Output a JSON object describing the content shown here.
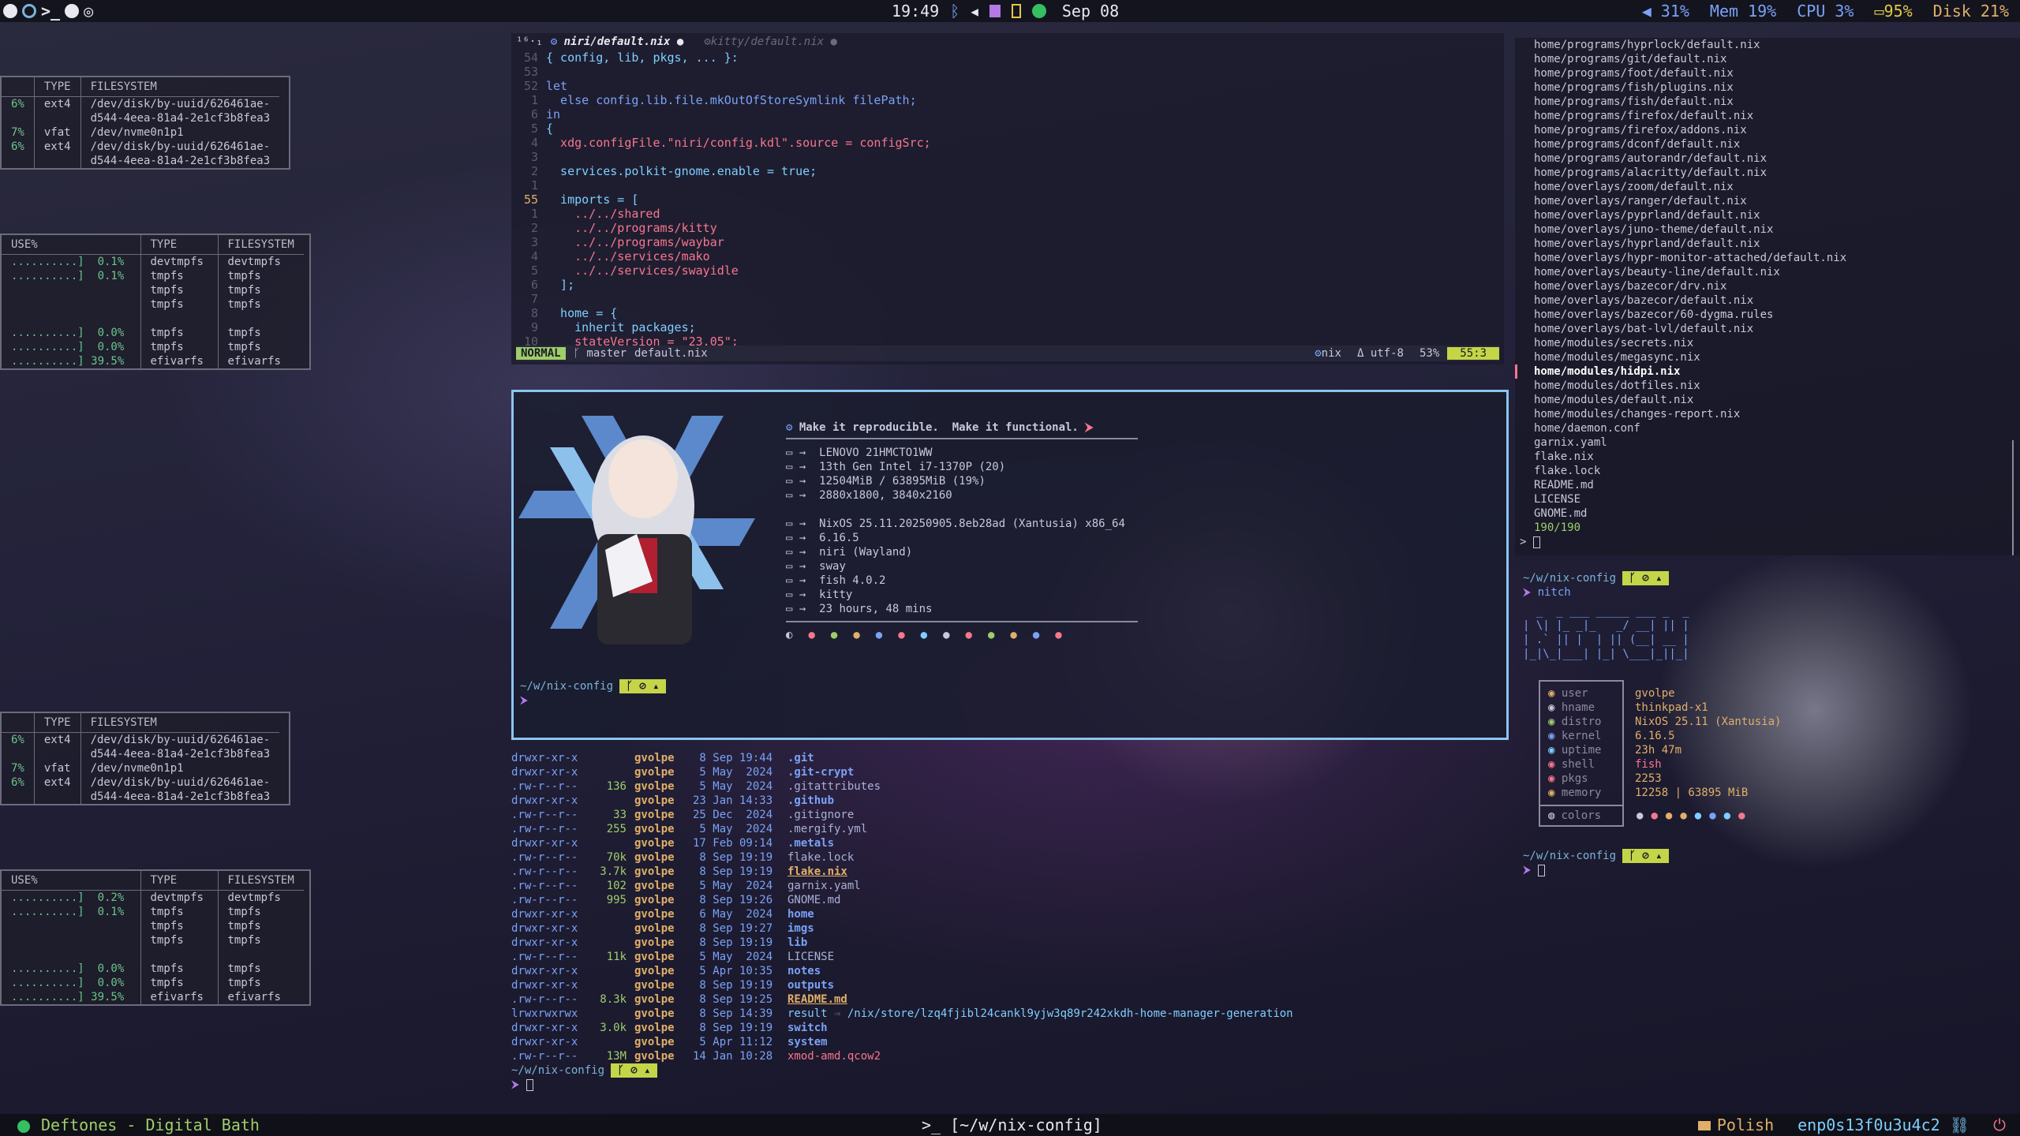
{
  "topbar": {
    "left_icons": [
      "nixos-icon",
      "firefox-icon",
      "terminal-icon",
      "telegram-icon",
      "network-icon"
    ],
    "clock": "19:49",
    "tray_icons": [
      "bluetooth-icon",
      "volume-icon",
      "tray-purple-icon",
      "battery-yellow-icon",
      "spotify-icon"
    ],
    "date": "Sep 08",
    "volume": "31%",
    "mem_label": "Mem",
    "mem_value": "19%",
    "cpu_label": "CPU",
    "cpu_value": "3%",
    "battery": "95%",
    "disk_label": "Disk",
    "disk_value": "21%"
  },
  "bottombar": {
    "song": "Deftones - Digital Bath",
    "window_title": "[~/w/nix-config]",
    "keyboard": "Polish",
    "network": "enp0s13f0u3u4c2"
  },
  "df_top1": {
    "headers": [
      "TYPE",
      "FILESYSTEM"
    ],
    "rows": [
      [
        "6%",
        "ext4",
        "/dev/disk/by-uuid/626461ae-\nd544-4eea-81a4-2e1cf3b8fea3"
      ],
      [
        "7%",
        "vfat",
        "/dev/nvme0n1p1"
      ],
      [
        "6%",
        "ext4",
        "/dev/disk/by-uuid/626461ae-\nd544-4eea-81a4-2e1cf3b8fea3"
      ]
    ]
  },
  "df_top2": {
    "headers": [
      "USE%",
      "TYPE",
      "FILESYSTEM"
    ],
    "rows": [
      [
        "..........]  0.1%",
        "devtmpfs",
        "devtmpfs"
      ],
      [
        "..........]  0.1%",
        "tmpfs",
        "tmpfs"
      ],
      [
        "",
        "tmpfs",
        "tmpfs"
      ],
      [
        "",
        "tmpfs",
        "tmpfs"
      ],
      [
        "",
        "",
        " "
      ],
      [
        "..........]  0.0%",
        "tmpfs",
        "tmpfs"
      ],
      [
        "..........]  0.0%",
        "tmpfs",
        "tmpfs"
      ],
      [
        "..........] 39.5%",
        "efivarfs",
        "efivarfs"
      ]
    ]
  },
  "df_bot1": {
    "headers": [
      "TYPE",
      "FILESYSTEM"
    ],
    "rows": [
      [
        "6%",
        "ext4",
        "/dev/disk/by-uuid/626461ae-\nd544-4eea-81a4-2e1cf3b8fea3"
      ],
      [
        "7%",
        "vfat",
        "/dev/nvme0n1p1"
      ],
      [
        "6%",
        "ext4",
        "/dev/disk/by-uuid/626461ae-\nd544-4eea-81a4-2e1cf3b8fea3"
      ]
    ]
  },
  "df_bot2": {
    "headers": [
      "USE%",
      "TYPE",
      "FILESYSTEM"
    ],
    "rows": [
      [
        "..........]  0.2%",
        "devtmpfs",
        "devtmpfs"
      ],
      [
        "..........]  0.1%",
        "tmpfs",
        "tmpfs"
      ],
      [
        "",
        "tmpfs",
        "tmpfs"
      ],
      [
        "",
        "tmpfs",
        "tmpfs"
      ],
      [
        "",
        "",
        " "
      ],
      [
        "..........]  0.0%",
        "tmpfs",
        "tmpfs"
      ],
      [
        "..........]  0.0%",
        "tmpfs",
        "tmpfs"
      ],
      [
        "..........] 39.5%",
        "efivarfs",
        "efivarfs"
      ]
    ]
  },
  "editor": {
    "tab1": "niri/default.nix",
    "tab2": "kitty/default.nix",
    "tab_prefix": "¹⁶·₁",
    "lines": [
      [
        "54",
        "{ config, lib, pkgs, ... }:"
      ],
      [
        "53",
        ""
      ],
      [
        "52",
        "let"
      ],
      [
        "1",
        "  else config.lib.file.mkOutOfStoreSymlink filePath;"
      ],
      [
        "6",
        "in"
      ],
      [
        "5",
        "{"
      ],
      [
        "4",
        "  xdg.configFile.\"niri/config.kdl\".source = configSrc;"
      ],
      [
        "3",
        ""
      ],
      [
        "2",
        "  services.polkit-gnome.enable = true;"
      ],
      [
        "1",
        ""
      ],
      [
        "55",
        "  imports = ["
      ],
      [
        "1",
        "    ../../shared"
      ],
      [
        "2",
        "    ../../programs/kitty"
      ],
      [
        "3",
        "    ../../programs/waybar"
      ],
      [
        "4",
        "    ../../services/mako"
      ],
      [
        "5",
        "    ../../services/swayidle"
      ],
      [
        "6",
        "  ];"
      ],
      [
        "7",
        ""
      ],
      [
        "8",
        "  home = {"
      ],
      [
        "9",
        "    inherit packages;"
      ],
      [
        "10",
        "    stateVersion = \"23.05\";"
      ]
    ],
    "status_mode": "NORMAL",
    "status_branch": "master",
    "status_file": "default.nix",
    "status_ft": "nix",
    "status_enc": "utf-8",
    "status_pct": "53%",
    "status_pos": "55:3"
  },
  "fetch": {
    "motto": "Make it reproducible.  Make it functional.",
    "hw": [
      "LENOVO 21HMCTO1WW",
      "13th Gen Intel i7-1370P (20)",
      "12504MiB / 63895MiB (19%)",
      "2880x1800, 3840x2160"
    ],
    "sw": [
      "NixOS 25.11.20250905.8eb28ad (Xantusia) x86_64",
      "6.16.5",
      "niri (Wayland)",
      "sway",
      "fish 4.0.2",
      "kitty",
      "23 hours, 48 mins"
    ],
    "prompt": "~/w/nix-config"
  },
  "ls": {
    "rows": [
      [
        "drwxr-xr-x",
        "",
        "gvolpe",
        " 8 Sep 19:44",
        ".git",
        "d"
      ],
      [
        "drwxr-xr-x",
        "",
        "gvolpe",
        " 5 May  2024",
        ".git-crypt",
        "d"
      ],
      [
        ".rw-r--r--",
        "136",
        "gvolpe",
        " 5 May  2024",
        ".gitattributes",
        "f"
      ],
      [
        "drwxr-xr-x",
        "",
        "gvolpe",
        "23 Jan 14:33",
        ".github",
        "d"
      ],
      [
        ".rw-r--r--",
        "33",
        "gvolpe",
        "25 Dec  2024",
        ".gitignore",
        "f"
      ],
      [
        ".rw-r--r--",
        "255",
        "gvolpe",
        " 5 May  2024",
        ".mergify.yml",
        "f"
      ],
      [
        "drwxr-xr-x",
        "",
        "gvolpe",
        "17 Feb 09:14",
        ".metals",
        "d"
      ],
      [
        ".rw-r--r--",
        "70k",
        "gvolpe",
        " 8 Sep 19:19",
        "flake.lock",
        "f"
      ],
      [
        ".rw-r--r--",
        "3.7k",
        "gvolpe",
        " 8 Sep 19:19",
        "flake.nix",
        "u"
      ],
      [
        ".rw-r--r--",
        "102",
        "gvolpe",
        " 5 May  2024",
        "garnix.yaml",
        "f"
      ],
      [
        ".rw-r--r--",
        "995",
        "gvolpe",
        " 8 Sep 19:26",
        "GNOME.md",
        "f"
      ],
      [
        "drwxr-xr-x",
        "",
        "gvolpe",
        " 6 May  2024",
        "home",
        "d"
      ],
      [
        "drwxr-xr-x",
        "",
        "gvolpe",
        " 8 Sep 19:27",
        "imgs",
        "d"
      ],
      [
        "drwxr-xr-x",
        "",
        "gvolpe",
        " 8 Sep 19:19",
        "lib",
        "d"
      ],
      [
        ".rw-r--r--",
        "11k",
        "gvolpe",
        " 5 May  2024",
        "LICENSE",
        "f"
      ],
      [
        "drwxr-xr-x",
        "",
        "gvolpe",
        " 5 Apr 10:35",
        "notes",
        "d"
      ],
      [
        "drwxr-xr-x",
        "",
        "gvolpe",
        " 8 Sep 19:19",
        "outputs",
        "d"
      ],
      [
        ".rw-r--r--",
        "8.3k",
        "gvolpe",
        " 8 Sep 19:25",
        "README.md",
        "u"
      ],
      [
        "lrwxrwxrwx",
        "",
        "gvolpe",
        " 8 Sep 14:39",
        "result",
        "l"
      ],
      [
        "drwxr-xr-x",
        "3.0k",
        "gvolpe",
        " 8 Sep 19:19",
        "switch",
        "d"
      ],
      [
        "drwxr-xr-x",
        "",
        "gvolpe",
        " 5 Apr 11:12",
        "system",
        "d"
      ],
      [
        ".rw-r--r--",
        "13M",
        "gvolpe",
        "14 Jan 10:28",
        "xmod-amd.qcow2",
        "x"
      ]
    ],
    "link_target": "/nix/store/lzq4fjibl24cankl9yjw3q89r242xkdh-home-manager-generation",
    "prompt": "~/w/nix-config"
  },
  "files": {
    "list": [
      "home/programs/hyprlock/default.nix",
      "home/programs/git/default.nix",
      "home/programs/foot/default.nix",
      "home/programs/fish/plugins.nix",
      "home/programs/fish/default.nix",
      "home/programs/firefox/default.nix",
      "home/programs/firefox/addons.nix",
      "home/programs/dconf/default.nix",
      "home/programs/autorandr/default.nix",
      "home/programs/alacritty/default.nix",
      "home/overlays/zoom/default.nix",
      "home/overlays/ranger/default.nix",
      "home/overlays/pyprland/default.nix",
      "home/overlays/juno-theme/default.nix",
      "home/overlays/hyprland/default.nix",
      "home/overlays/hypr-monitor-attached/default.nix",
      "home/overlays/beauty-line/default.nix",
      "home/overlays/bazecor/drv.nix",
      "home/overlays/bazecor/default.nix",
      "home/overlays/bazecor/60-dygma.rules",
      "home/overlays/bat-lvl/default.nix",
      "home/modules/secrets.nix",
      "home/modules/megasync.nix",
      "home/modules/hidpi.nix",
      "home/modules/dotfiles.nix",
      "home/modules/default.nix",
      "home/modules/changes-report.nix",
      "home/daemon.conf",
      "garnix.yaml",
      "flake.nix",
      "flake.lock",
      "README.md",
      "LICENSE",
      "GNOME.md"
    ],
    "selected_index": 23,
    "count": "190/190",
    "input_prompt": ">"
  },
  "term2": {
    "prompt": "~/w/nix-config",
    "cmd": "nitch",
    "ascii": [
      "  _  _ ___ _____ ___ _  _ ",
      "| \\| |_ _|_   _/ __| || |",
      "| .` || |  | || (__| __ |",
      "|_|\\_|___| |_| \\___|_||_|"
    ],
    "keys": [
      "user",
      "hname",
      "distro",
      "kernel",
      "uptime",
      "shell",
      "pkgs",
      "memory"
    ],
    "vals": [
      "gvolpe",
      "thinkpad-x1",
      "NixOS 25.11 (Xantusia)",
      "6.16.5",
      "23h 47m",
      "fish",
      "2253",
      "12258 | 63895 MiB"
    ],
    "colors_label": "colors",
    "prompt2": "~/w/nix-config"
  }
}
